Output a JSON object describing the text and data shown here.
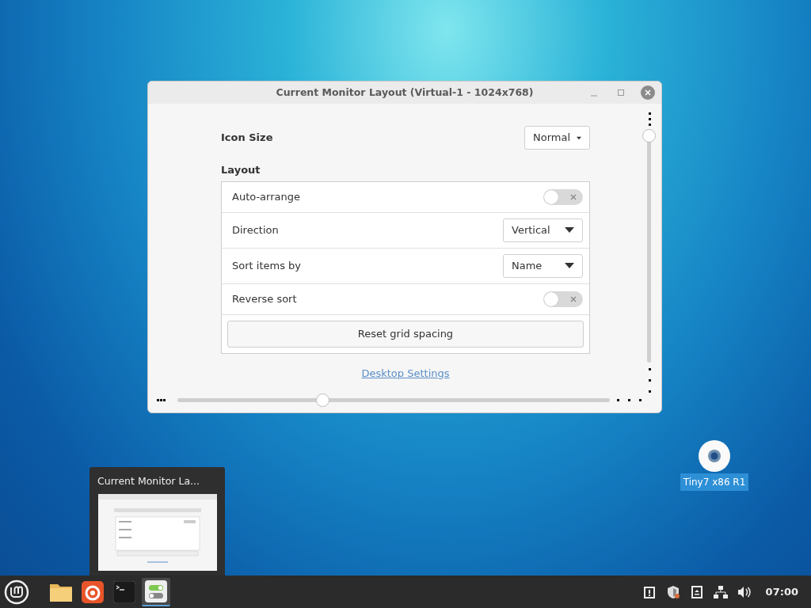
{
  "window": {
    "title": "Current Monitor Layout (Virtual-1 - 1024x768)"
  },
  "icon_size": {
    "label": "Icon Size",
    "value": "Normal"
  },
  "layout": {
    "heading": "Layout",
    "rows": [
      {
        "kind": "switch",
        "label": "Auto-arrange",
        "on": false
      },
      {
        "kind": "dropdown",
        "label": "Direction",
        "value": "Vertical"
      },
      {
        "kind": "dropdown",
        "label": "Sort items by",
        "value": "Name"
      },
      {
        "kind": "switch",
        "label": "Reverse sort",
        "on": false
      }
    ],
    "button": "Reset grid spacing"
  },
  "link": "Desktop Settings",
  "desktop_icons": [
    {
      "label": "Tiny7 x86 R1",
      "selected": true
    }
  ],
  "preview": {
    "title": "Current Monitor La..."
  },
  "taskbar": {
    "apps": [
      {
        "kind": "files",
        "selected": false
      },
      {
        "kind": "browser",
        "selected": false
      },
      {
        "kind": "terminal",
        "selected": false
      },
      {
        "kind": "settings",
        "selected": true
      }
    ],
    "clock": "07:00"
  }
}
